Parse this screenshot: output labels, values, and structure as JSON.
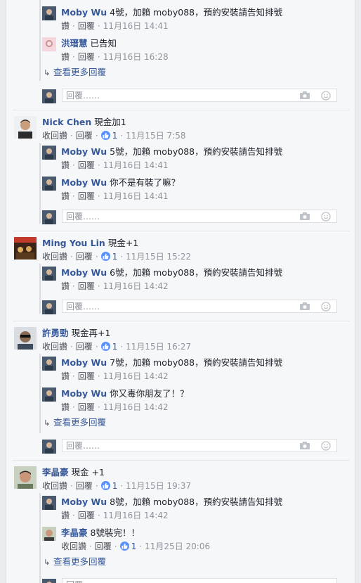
{
  "placeholder": "回覆……",
  "more_replies": "查看更多回覆",
  "labels": {
    "like": "讚",
    "unlike": "收回讚",
    "reply": "回覆"
  },
  "comments": [
    {
      "name": "Nick Chen",
      "text": "現金加1",
      "likes": "1",
      "time": "11月15日 7:58"
    },
    {
      "name": "Ming You Lin",
      "text": "現金+1",
      "likes": "1",
      "time": "11月15日 15:22"
    },
    {
      "name": "許勇勁",
      "text": "現金再+1",
      "likes": "1",
      "time": "11月15日 16:27"
    },
    {
      "name": "李晶豪",
      "text": "現金 +1",
      "likes": "1",
      "time": "11月15日 19:37"
    }
  ],
  "replies": {
    "top": [
      {
        "name": "Moby Wu",
        "text": "4號，加賴 moby088，預約安裝請告知排號",
        "time": "11月16日 14:41"
      },
      {
        "name": "洪瑨慧",
        "text": "已告知",
        "time": "11月16日 16:28"
      }
    ],
    "c1": [
      {
        "name": "Moby Wu",
        "text": "5號，加賴 moby088，預約安裝請告知排號",
        "time": "11月16日 14:41"
      },
      {
        "name": "Moby Wu",
        "text": "你不是有裝了嘛？",
        "time": "11月16日 14:41"
      }
    ],
    "c2": [
      {
        "name": "Moby Wu",
        "text": "6號，加賴 moby088，預約安裝請告知排號",
        "time": "11月16日 14:42"
      }
    ],
    "c3": [
      {
        "name": "Moby Wu",
        "text": "7號，加賴 moby088，預約安裝請告知排號",
        "time": "11月16日 14:42"
      },
      {
        "name": "Moby Wu",
        "text": "你又毒你朋友了！？",
        "time": "11月16日 14:42"
      }
    ],
    "c4": [
      {
        "name": "Moby Wu",
        "text": "8號，加賴 moby088，預約安裝請告知排號",
        "time": "11月16日 14:42"
      },
      {
        "name": "李晶豪",
        "text": "8號裝完！！",
        "likes": "1",
        "time": "11月25日 20:06"
      }
    ]
  },
  "colors": {
    "link": "#365899",
    "meta": "#90949c",
    "like_badge": "#5890ff",
    "panel": "#f6f7f9"
  }
}
